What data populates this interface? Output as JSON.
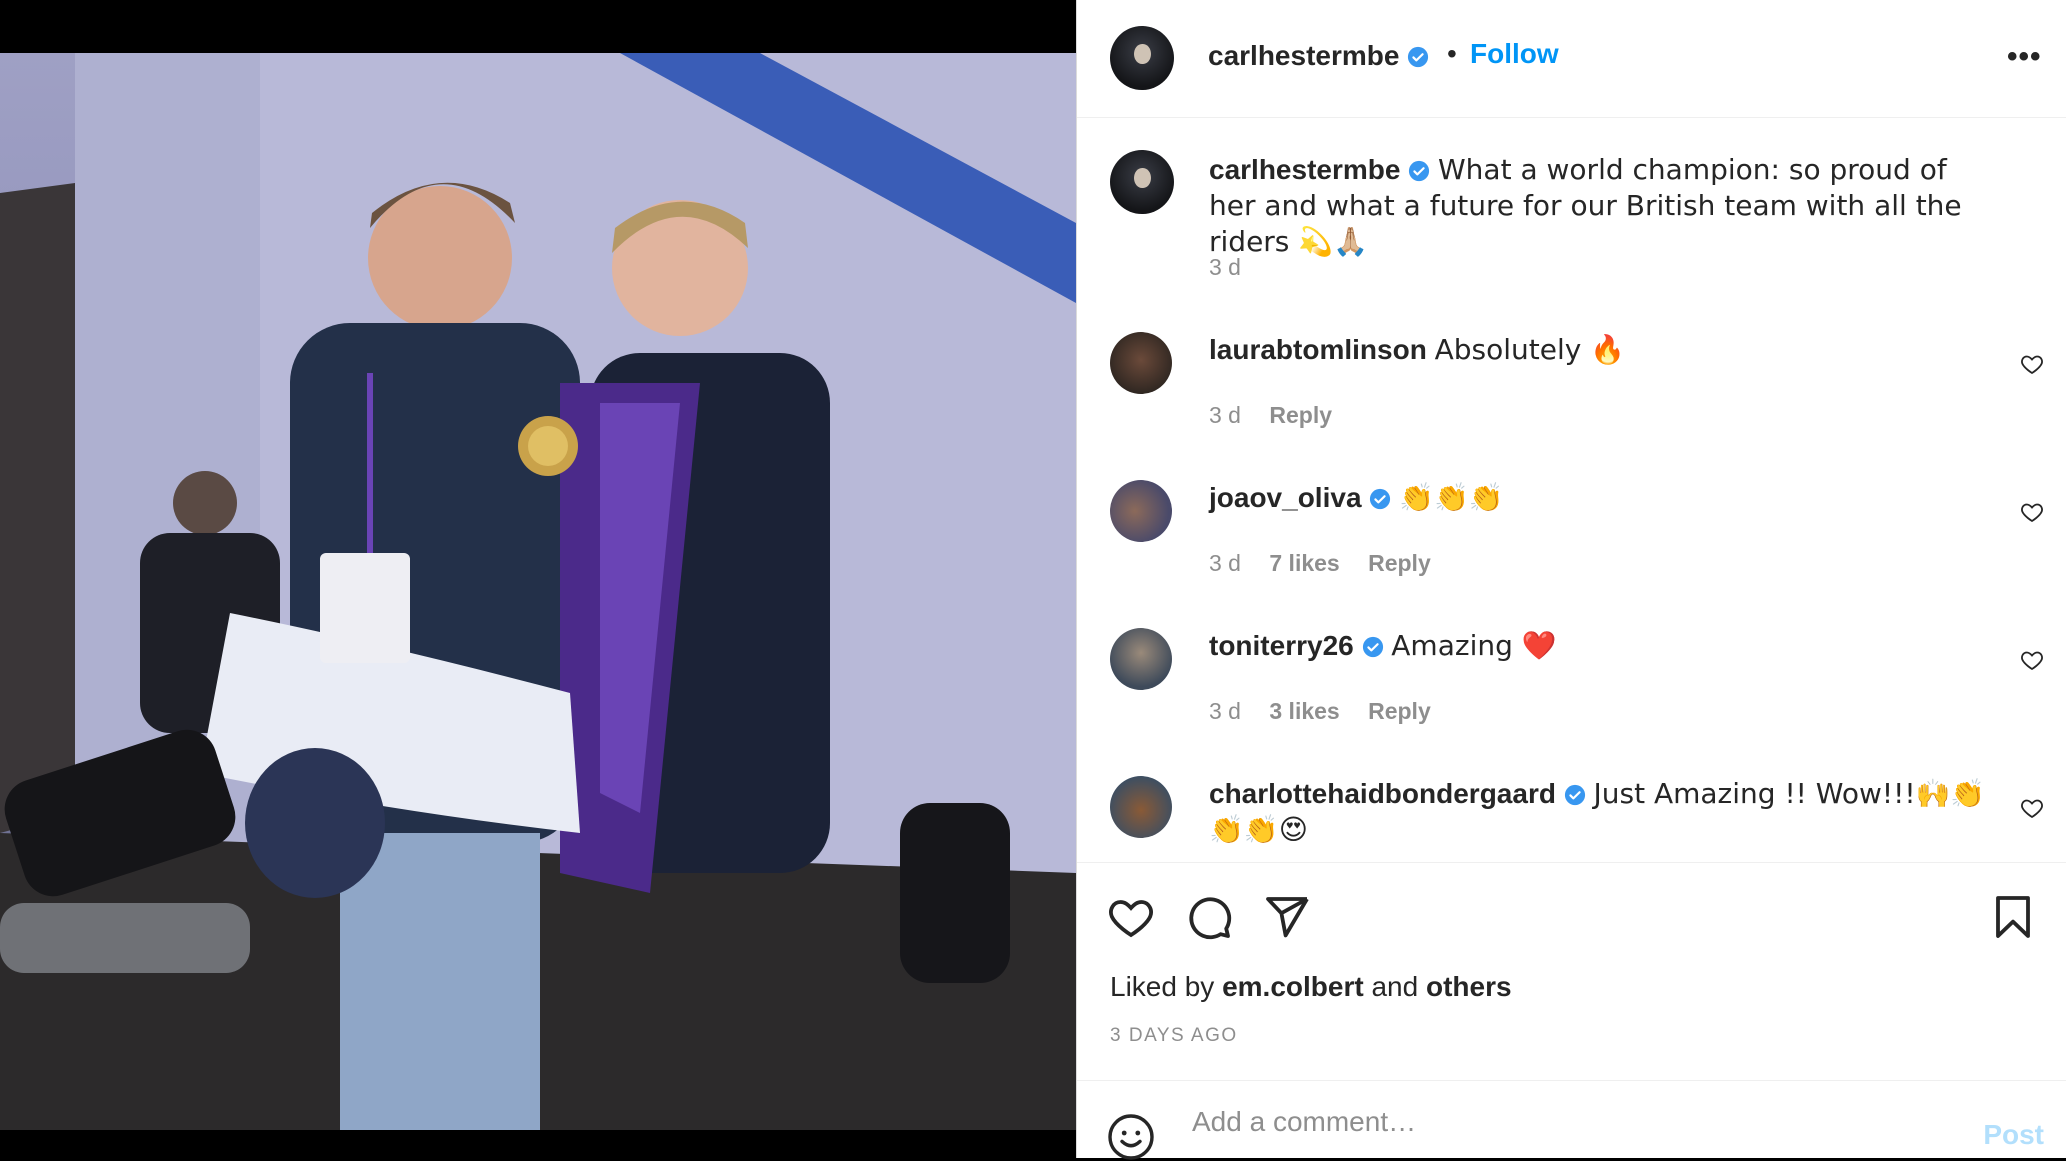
{
  "post": {
    "author": "carlhestermbe",
    "follow_label": "Follow",
    "separator": "•",
    "more_label": "•••",
    "caption": "What a world champion: so proud of her and what a future for our British team with all the riders 💫🙏🏼",
    "caption_time": "3 d"
  },
  "comments": [
    {
      "username": "laurabtomlinson",
      "verified": false,
      "text": "Absolutely 🔥",
      "time": "3 d",
      "likes": "",
      "reply_label": "Reply"
    },
    {
      "username": "joaov_oliva",
      "verified": true,
      "text": "👏👏👏",
      "time": "3 d",
      "likes": "7 likes",
      "reply_label": "Reply"
    },
    {
      "username": "toniterry26",
      "verified": true,
      "text": "Amazing ❤️",
      "time": "3 d",
      "likes": "3 likes",
      "reply_label": "Reply"
    },
    {
      "username": "charlottehaidbondergaard",
      "verified": true,
      "text": "Just Amazing !! Wow!!!🙌👏👏👏😍",
      "time": "",
      "likes": "",
      "reply_label": ""
    }
  ],
  "actions": {
    "liked_prefix": "Liked by",
    "liked_user": "em.colbert",
    "liked_and": "and",
    "liked_others": "others",
    "timestamp": "3 DAYS AGO"
  },
  "add_comment": {
    "placeholder": "Add a comment…",
    "post_label": "Post"
  },
  "icons": [
    "verified-badge-icon",
    "heart-icon",
    "comment-icon",
    "share-icon",
    "bookmark-icon",
    "emoji-icon",
    "more-icon"
  ],
  "colors": {
    "accent": "#0095f6",
    "verified": "#3897f0",
    "post_disabled": "#b2dffc",
    "muted": "#8e8e8e",
    "text": "#262626"
  }
}
